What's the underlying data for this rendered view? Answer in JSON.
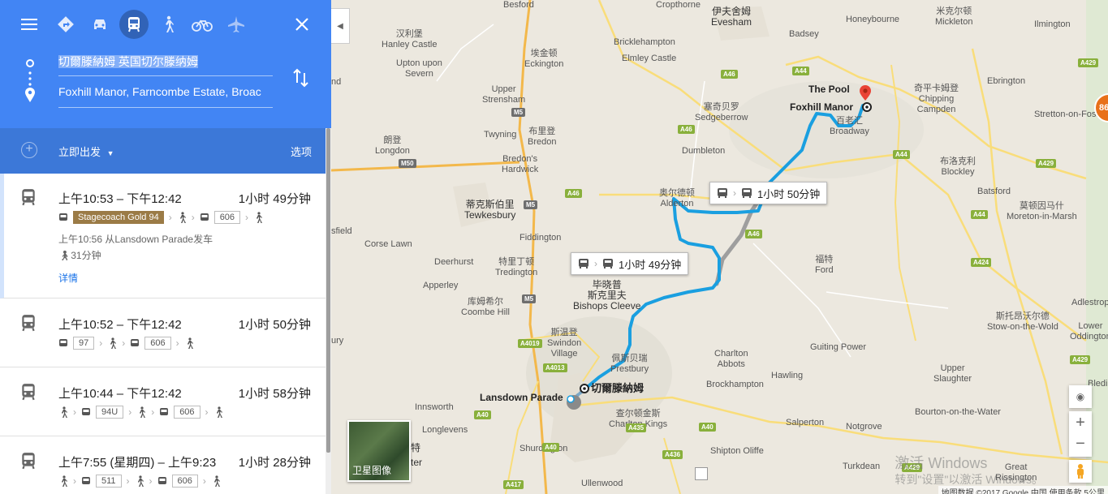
{
  "modes": {
    "menu": "menu-icon",
    "items": [
      "directions-icon",
      "car-icon",
      "transit-icon",
      "walk-icon",
      "bicycle-icon",
      "flight-icon"
    ],
    "active": "transit-icon",
    "close": "close-icon"
  },
  "origin": {
    "value": "切爾滕納姆 英国切尔滕纳姆"
  },
  "destination": {
    "value": "Foxhill Manor, Farncombe Estate, Broac"
  },
  "depart": {
    "label": "立即出发",
    "options_label": "选项"
  },
  "routes": [
    {
      "time": "上午10:53 – 下午12:42",
      "duration": "1小时 49分钟",
      "line1": "Stagecoach Gold 94",
      "line2": "606",
      "depart_note": "上午10:56 从Lansdown Parade发车",
      "walk_note": "31分钟",
      "details": "详情"
    },
    {
      "time": "上午10:52 – 下午12:42",
      "duration": "1小时 50分钟",
      "line1": "97",
      "line2": "606"
    },
    {
      "time": "上午10:44 – 下午12:42",
      "duration": "1小时 58分钟",
      "line1": "94U",
      "line2": "606"
    },
    {
      "time": "上午7:55 (星期四) – 上午9:23",
      "duration": "1小时 28分钟",
      "line1": "511",
      "line2": "606"
    }
  ],
  "map": {
    "tooltip1": "1小时 50分钟",
    "tooltip2": "1小时 49分钟",
    "origin_label": "切爾滕納姆",
    "lansdown": "Lansdown Parade",
    "foxhill": "Foxhill Manor",
    "thepool": "The Pool",
    "satellite": "卫星图像",
    "footer": "地图数据 ©2017 Google   中国   使用条款   5公里",
    "watermark1": "激活 Windows",
    "watermark2": "转到\"设置\"以激活 Windows。",
    "badge": "86",
    "places": [
      {
        "t": "伊夫舍姆\nEvesham",
        "cls": "big"
      },
      {
        "t": "汉利堡\nHanley Castle",
        "cls": ""
      },
      {
        "t": "埃金顿\nEckington",
        "cls": ""
      },
      {
        "t": "Upton upon\nSevern",
        "cls": ""
      },
      {
        "t": "Bricklehampton",
        "cls": ""
      },
      {
        "t": "Elmley Castle",
        "cls": ""
      },
      {
        "t": "Honeybourne",
        "cls": ""
      },
      {
        "t": "米克尔顿\nMickleton",
        "cls": ""
      },
      {
        "t": "Badsey",
        "cls": ""
      },
      {
        "t": "Ilmington",
        "cls": ""
      },
      {
        "t": "Upper\nStrensham",
        "cls": ""
      },
      {
        "t": "塞奇贝罗\nSedgeberrow",
        "cls": ""
      },
      {
        "t": "奇平卡姆登\nChipping\nCampden",
        "cls": ""
      },
      {
        "t": "Ebrington",
        "cls": ""
      },
      {
        "t": "Stretton-on-Fosse",
        "cls": ""
      },
      {
        "t": "百老汇\nBroadway",
        "cls": ""
      },
      {
        "t": "Twyning",
        "cls": ""
      },
      {
        "t": "布里登\nBredon",
        "cls": ""
      },
      {
        "t": "朗登\nLongdon",
        "cls": ""
      },
      {
        "t": "Bredon's\nHardwick",
        "cls": ""
      },
      {
        "t": "Dumbleton",
        "cls": ""
      },
      {
        "t": "布洛克利\nBlockley",
        "cls": ""
      },
      {
        "t": "Batsford",
        "cls": ""
      },
      {
        "t": "莫顿因马什\nMoreton-in-Marsh",
        "cls": ""
      },
      {
        "t": "奥尔德顿\nAlderton",
        "cls": ""
      },
      {
        "t": "蒂克斯伯里\nTewkesbury",
        "cls": "big"
      },
      {
        "t": "Fiddington",
        "cls": ""
      },
      {
        "t": "Corse Lawn",
        "cls": ""
      },
      {
        "t": "Deerhurst",
        "cls": ""
      },
      {
        "t": "特里丁顿\nTredington",
        "cls": ""
      },
      {
        "t": "Apperley",
        "cls": ""
      },
      {
        "t": "毕晓普\n斯克里夫\nBishops Cleeve",
        "cls": "big"
      },
      {
        "t": "福特\nFord",
        "cls": ""
      },
      {
        "t": "库姆希尔\nCoombe Hill",
        "cls": ""
      },
      {
        "t": "斯温登\nSwindon\nVillage",
        "cls": ""
      },
      {
        "t": "佩斯贝瑞\nPrestbury",
        "cls": ""
      },
      {
        "t": "Charlton\nAbbots",
        "cls": ""
      },
      {
        "t": "Guiting Power",
        "cls": ""
      },
      {
        "t": "斯托昂沃尔德\nStow-on-the-Wold",
        "cls": ""
      },
      {
        "t": "Lower\nOddington",
        "cls": ""
      },
      {
        "t": "Adlestrop",
        "cls": ""
      },
      {
        "t": "Brockhampton",
        "cls": ""
      },
      {
        "t": "Hawling",
        "cls": ""
      },
      {
        "t": "Upper\nSlaughter",
        "cls": ""
      },
      {
        "t": "Innsworth",
        "cls": ""
      },
      {
        "t": "Longlevens",
        "cls": ""
      },
      {
        "t": "查尔顿金斯\nCharlton Kings",
        "cls": ""
      },
      {
        "t": "Salperton",
        "cls": ""
      },
      {
        "t": "Notgrove",
        "cls": ""
      },
      {
        "t": "Bourton-on-the-Water",
        "cls": ""
      },
      {
        "t": "Shurdington",
        "cls": ""
      },
      {
        "t": "Shipton Oliffe",
        "cls": ""
      },
      {
        "t": "Turkdean",
        "cls": ""
      },
      {
        "t": "Great\nRissington",
        "cls": ""
      },
      {
        "t": "Ullenwood",
        "cls": ""
      },
      {
        "t": "Besford",
        "cls": ""
      },
      {
        "t": "Cropthorne",
        "cls": ""
      },
      {
        "t": "sfield",
        "cls": ""
      },
      {
        "t": "ury",
        "cls": ""
      },
      {
        "t": "nd",
        "cls": ""
      },
      {
        "t": "Bledi",
        "cls": ""
      },
      {
        "t": "特",
        "cls": "big"
      },
      {
        "t": "ter",
        "cls": "big"
      }
    ],
    "roads": [
      "A44",
      "A46",
      "A429",
      "A46",
      "M5",
      "A46",
      "M50",
      "A44",
      "A429",
      "A44",
      "A46",
      "M5",
      "M5",
      "A424",
      "A4019",
      "A4013",
      "A429",
      "A40",
      "A40",
      "A436",
      "A40",
      "A417",
      "A429",
      "A435"
    ]
  },
  "colors": {
    "header": "#4285f4",
    "bar": "#3c78d8",
    "route": "#1a9fe0",
    "alt_route": "#9e9e9e",
    "brand_chip": "#9b7b46"
  }
}
